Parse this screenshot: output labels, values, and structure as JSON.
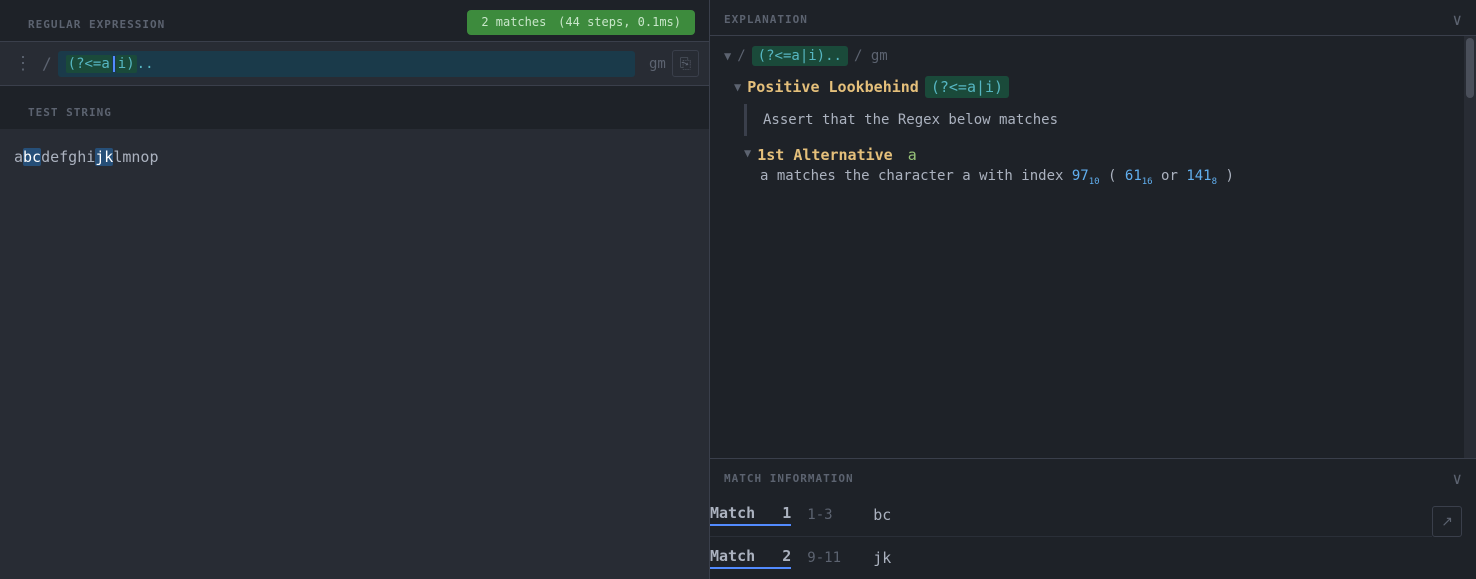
{
  "left": {
    "section_regex": "REGULAR EXPRESSION",
    "match_badge": "2 matches",
    "match_detail": "(44 steps, 0.1ms)",
    "regex_slash_open": "/",
    "regex_content_highlight": "(?<=a|i)",
    "regex_content_dots": "..",
    "regex_slash_close": "/",
    "regex_flags": "gm",
    "section_test": "TEST STRING",
    "test_string": "abcdefghijklmnop",
    "copy_icon": "⎘"
  },
  "right": {
    "explanation_title": "EXPLANATION",
    "regex_display_slash1": "/",
    "regex_display_content": "(?<=a|i)..",
    "regex_display_slash2": "/",
    "regex_display_flags": "gm",
    "positive_lookbehind_label": "Positive Lookbehind",
    "positive_lookbehind_regex": "(?<=a|i)",
    "assert_text": "Assert that the Regex below matches",
    "alt_label": "1st Alternative",
    "alt_char": "a",
    "alt_desc_prefix": "a matches the character a with index ",
    "index_97": "97",
    "sub_10": "10",
    "index_61": "61",
    "sub_16": "16",
    "index_141": "141",
    "sub_8": "8"
  },
  "match_info": {
    "title": "MATCH INFORMATION",
    "match1_label": "Match",
    "match1_num": "1",
    "match1_range": "1-3",
    "match1_value": "bc",
    "match2_label": "Match",
    "match2_num": "2",
    "match2_range": "9-11",
    "match2_value": "jk",
    "share_icon": "↗"
  }
}
